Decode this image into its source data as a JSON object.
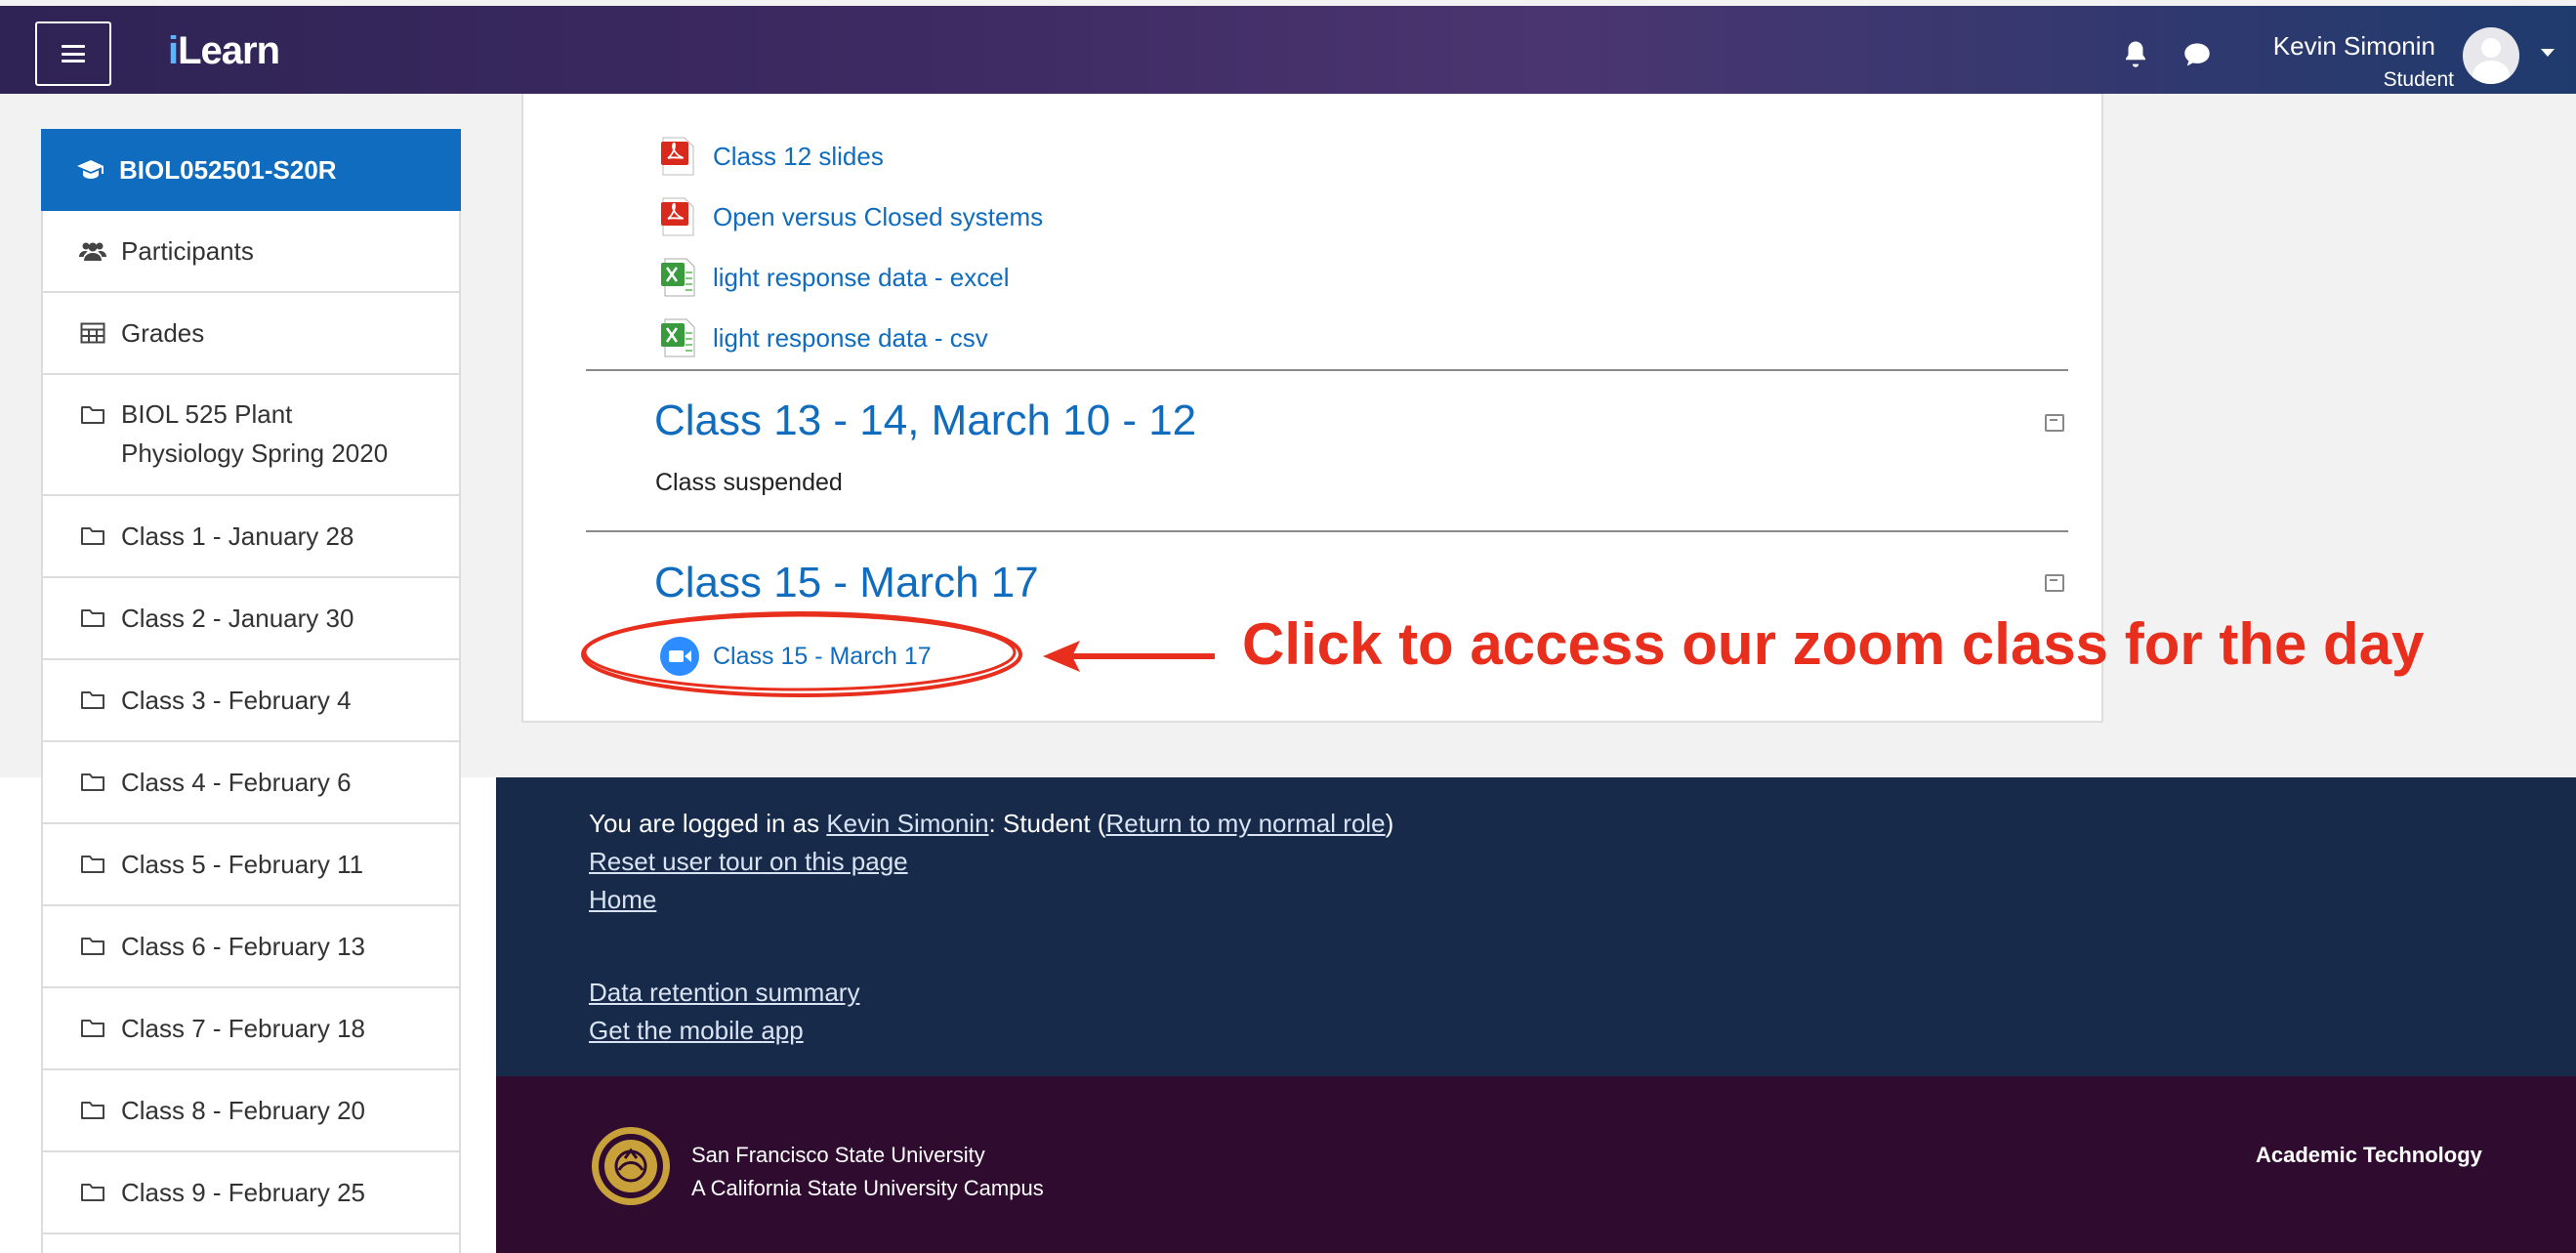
{
  "navbar": {
    "brand": "iLearn",
    "user_name": "Kevin Simonin",
    "user_role": "Student",
    "icons": [
      "menu-icon",
      "bell-icon",
      "chat-icon",
      "avatar",
      "chevron-down-icon"
    ]
  },
  "sidebar": {
    "items": [
      {
        "label": "BIOL052501-S20R",
        "icon": "graduation-cap-icon",
        "active": true
      },
      {
        "label": "Participants",
        "icon": "users-icon"
      },
      {
        "label": "Grades",
        "icon": "table-icon"
      },
      {
        "label": "BIOL 525 Plant Physiology Spring 2020",
        "line1": "BIOL 525 Plant",
        "line2": "Physiology Spring 2020",
        "icon": "folder-icon"
      },
      {
        "label": "Class 1 - January 28",
        "icon": "folder-icon"
      },
      {
        "label": "Class 2 - January 30",
        "icon": "folder-icon"
      },
      {
        "label": "Class 3 - February 4",
        "icon": "folder-icon"
      },
      {
        "label": "Class 4 - February 6",
        "icon": "folder-icon"
      },
      {
        "label": "Class 5 - February 11",
        "icon": "folder-icon"
      },
      {
        "label": "Class 6 - February 13",
        "icon": "folder-icon"
      },
      {
        "label": "Class 7 - February 18",
        "icon": "folder-icon"
      },
      {
        "label": "Class 8 - February 20",
        "icon": "folder-icon"
      },
      {
        "label": "Class 9 - February 25",
        "icon": "folder-icon"
      }
    ]
  },
  "content": {
    "files": [
      {
        "label": "Class 12 slides",
        "type": "pdf"
      },
      {
        "label": "Open versus Closed systems",
        "type": "pdf"
      },
      {
        "label": "light response data - excel",
        "type": "spreadsheet"
      },
      {
        "label": "light response data - csv",
        "type": "spreadsheet"
      }
    ],
    "section_13": {
      "title": "Class 13 - 14, March 10 - 12",
      "summary": "Class suspended"
    },
    "section_15": {
      "title": "Class 15 - March 17",
      "zoom_link": "Class 15 - March 17"
    }
  },
  "annotation": {
    "callout": "Click to access our zoom class for the day",
    "color": "#e82e1c"
  },
  "footer": {
    "logged_in_prefix": "You are logged in as ",
    "logged_in_user": "Kevin Simonin",
    "logged_in_role": ": Student (",
    "return_link": "Return to my normal role",
    "close_paren": ")",
    "reset_tour": "Reset user tour on this page",
    "home": "Home",
    "data_retention": "Data retention summary",
    "mobile_app": "Get the mobile app",
    "university": "San Francisco State University",
    "campus": "A California State University Campus",
    "academic_technology": "Academic Technology"
  },
  "colors": {
    "link": "#0f6cbf",
    "sidebar_active": "#0f6cbf",
    "footer_navy": "#172a4a",
    "footer_purple": "#2f0b30",
    "annotation_red": "#e82e1c"
  }
}
